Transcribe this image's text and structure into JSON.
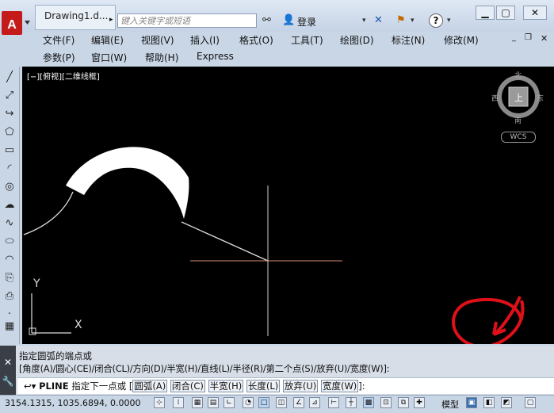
{
  "title_bar": {
    "document_title": "Drawing1.d...",
    "search_placeholder": "键入关键字或短语",
    "login_label": "登录"
  },
  "menus": {
    "row1": [
      "文件(F)",
      "编辑(E)",
      "视图(V)",
      "插入(I)",
      "格式(O)",
      "工具(T)",
      "绘图(D)",
      "标注(N)",
      "修改(M)"
    ],
    "row2": [
      "参数(P)",
      "窗口(W)",
      "帮助(H)",
      "Express"
    ]
  },
  "viewport": {
    "label": "[−][俯视][二维线框]",
    "viewcube": {
      "north": "北",
      "south": "南",
      "west": "西",
      "east": "东",
      "face": "上",
      "wcs": "WCS"
    },
    "ucs": {
      "y": "Y",
      "x": "X"
    }
  },
  "command": {
    "line1": "指定圆弧的端点或",
    "line2": "[角度(A)/圆心(CE)/闭合(CL)/方向(D)/半宽(H)/直线(L)/半径(R)/第二个点(S)/放弃(U)/宽度(W)]:",
    "prompt_cmd": "PLINE",
    "prompt_text": "指定下一点或",
    "options": [
      "圆弧(A)",
      "闭合(C)",
      "半宽(H)",
      "长度(L)",
      "放弃(U)",
      "宽度(W)"
    ],
    "prompt_end": "]:"
  },
  "status": {
    "coords": "3154.1315, 1035.6894, 0.0000",
    "model_label": "模型"
  },
  "colors": {
    "canvas_bg": "#000000",
    "annotation_red": "#e0101a",
    "crosshair_h": "#d68a6a"
  }
}
